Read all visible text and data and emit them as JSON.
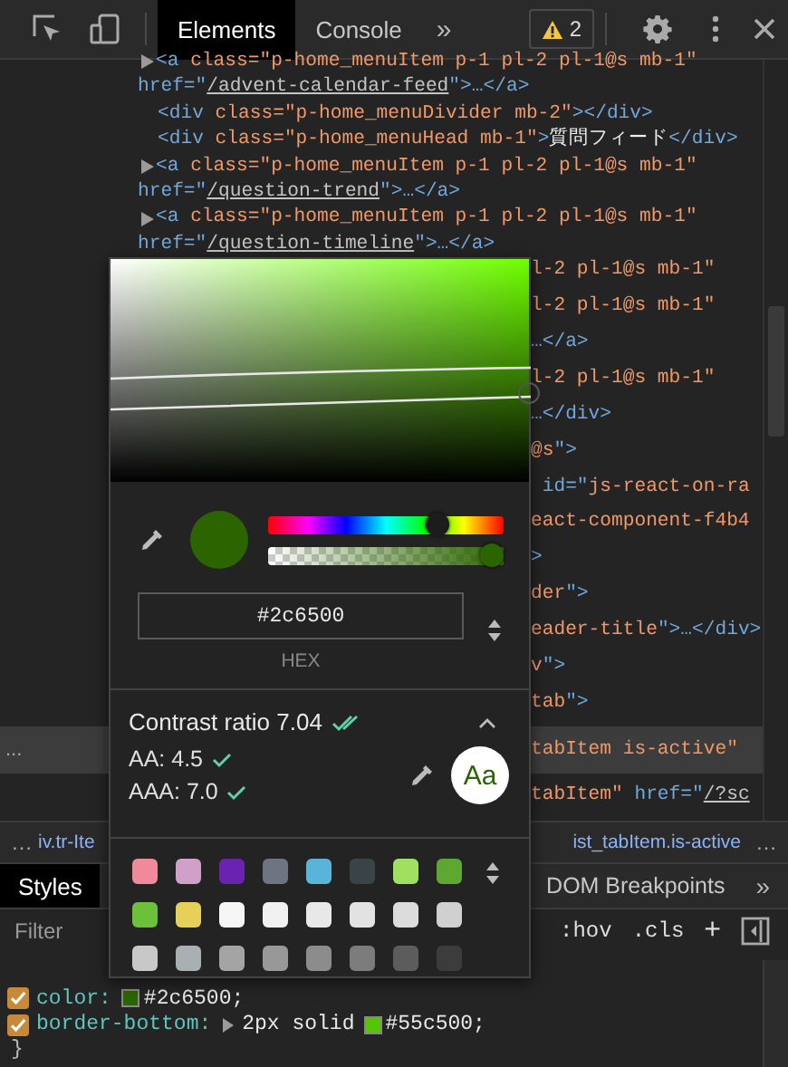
{
  "toolbar": {
    "tabs": [
      {
        "label": "Elements",
        "selected": true
      },
      {
        "label": "Console",
        "selected": false
      }
    ],
    "more_tabs": "»",
    "warnings": "2"
  },
  "dom_lines": [
    {
      "kind": "open",
      "expanded": false,
      "tokens": [
        {
          "t": "<a ",
          "kind": "tag"
        },
        {
          "t": "class=\"p-home_menuItem p-1 pl-2 pl-1@s mb-1\"",
          "kind": "attr"
        }
      ]
    },
    {
      "kind": "wrap",
      "tokens": [
        {
          "t": "href=\"",
          "kind": "tag"
        },
        {
          "t": "/advent-calendar-feed",
          "kind": "link"
        },
        {
          "t": "\">…</a>",
          "kind": "tag"
        }
      ]
    },
    {
      "kind": "leaf",
      "tokens": [
        {
          "t": "<div ",
          "kind": "tag"
        },
        {
          "t": "class=\"p-home_menuDivider mb-2\"",
          "kind": "attr"
        },
        {
          "t": "></div>",
          "kind": "tag"
        }
      ]
    },
    {
      "kind": "leaf",
      "tokens": [
        {
          "t": "<div ",
          "kind": "tag"
        },
        {
          "t": "class=\"p-home_menuHead mb-1\"",
          "kind": "attr"
        },
        {
          "t": ">",
          "kind": "tag"
        },
        {
          "t": "質問フィード",
          "kind": "text"
        },
        {
          "t": "</div>",
          "kind": "tag"
        }
      ]
    },
    {
      "kind": "open",
      "expanded": false,
      "tokens": [
        {
          "t": "<a ",
          "kind": "tag"
        },
        {
          "t": "class=\"p-home_menuItem p-1 pl-2 pl-1@s mb-1\"",
          "kind": "attr"
        }
      ]
    },
    {
      "kind": "wrap",
      "tokens": [
        {
          "t": "href=\"",
          "kind": "tag"
        },
        {
          "t": "/question-trend",
          "kind": "link"
        },
        {
          "t": "\">…</a>",
          "kind": "tag"
        }
      ]
    },
    {
      "kind": "open",
      "expanded": false,
      "tokens": [
        {
          "t": "<a ",
          "kind": "tag"
        },
        {
          "t": "class=\"p-home_menuItem p-1 pl-2 pl-1@s mb-1\"",
          "kind": "attr"
        }
      ]
    },
    {
      "kind": "wrap",
      "tokens": [
        {
          "t": "href=\"",
          "kind": "tag"
        },
        {
          "t": "/question-timeline",
          "kind": "link"
        },
        {
          "t": "\">…</a>",
          "kind": "tag"
        }
      ]
    }
  ],
  "fragments": [
    {
      "selected": false,
      "tokens": [
        {
          "t": "l-2 pl-1@s mb-1\"",
          "kind": "attr"
        }
      ]
    },
    {
      "selected": false,
      "tokens": [
        {
          "t": "l-2 pl-1@s mb-1\"",
          "kind": "attr"
        }
      ]
    },
    {
      "selected": false,
      "tokens": [
        {
          "t": "…</a>",
          "kind": "tag"
        }
      ]
    },
    {
      "selected": false,
      "tokens": [
        {
          "t": "l-2 pl-1@s mb-1\"",
          "kind": "attr"
        }
      ]
    },
    {
      "selected": false,
      "tokens": [
        {
          "t": "…</div>",
          "kind": "tag"
        }
      ]
    },
    {
      "selected": false,
      "tokens": [
        {
          "t": "@s",
          "kind": "attr"
        },
        {
          "t": "\">",
          "kind": "tag"
        }
      ]
    },
    {
      "selected": false,
      "tokens": [
        {
          "t": " id=\"",
          "kind": "tag"
        },
        {
          "t": "js-react-on-ra",
          "kind": "attr"
        }
      ]
    },
    {
      "selected": false,
      "tokens": [
        {
          "t": "eact-component-f4b4",
          "kind": "attr"
        }
      ]
    },
    {
      "selected": false,
      "tokens": [
        {
          "t": ">",
          "kind": "tag"
        }
      ]
    },
    {
      "selected": false,
      "tokens": [
        {
          "t": "der",
          "kind": "attr"
        },
        {
          "t": "\">",
          "kind": "tag"
        }
      ]
    },
    {
      "selected": false,
      "tokens": [
        {
          "t": "eader-title",
          "kind": "attr"
        },
        {
          "t": "\">…</div>",
          "kind": "tag"
        }
      ]
    },
    {
      "selected": false,
      "tokens": [
        {
          "t": "v",
          "kind": "attr"
        },
        {
          "t": "\">",
          "kind": "tag"
        }
      ]
    },
    {
      "selected": false,
      "tokens": [
        {
          "t": "tab",
          "kind": "attr"
        },
        {
          "t": "\">",
          "kind": "tag"
        }
      ]
    },
    {
      "selected": true,
      "marker": "...",
      "tokens": [
        {
          "t": "tabItem is-active\"",
          "kind": "attr"
        }
      ]
    },
    {
      "selected": false,
      "tokens": [
        {
          "t": "tabItem\"",
          "kind": "attr"
        },
        {
          "t": " href=\"",
          "kind": "tag"
        },
        {
          "t": "/?sc",
          "kind": "link"
        }
      ]
    }
  ],
  "breadcrumbs": {
    "start": "…",
    "items": [
      "iv.tr-Ite",
      "ist_tabItem.is-active"
    ],
    "end": "…"
  },
  "styles_tabs": {
    "tabs": [
      {
        "label": "Styles",
        "selected": true
      },
      {
        "label": "DOM Breakpoints",
        "selected": false
      }
    ],
    "more": "»"
  },
  "filter": {
    "placeholder": "Filter",
    "hov": ":hov",
    "cls": ".cls",
    "add": "+"
  },
  "declarations": [
    {
      "property": "color:",
      "checked": true,
      "value": "#2c6500;"
    },
    {
      "property": "border-bottom:",
      "checked": true,
      "expanded": false,
      "value_prefix": "2px solid",
      "value": "#55c500;"
    }
  ],
  "closing_brace": "}",
  "picker": {
    "hue_slider": {
      "level": 0.74
    },
    "alpha_slider": {
      "level": 1.0
    },
    "hex": "#2c6500",
    "format": "HEX",
    "contrast": {
      "label": "Contrast ratio",
      "ratio": "7.04",
      "passes": true,
      "expanded": true,
      "preview": "Aa",
      "levels": [
        {
          "label": "AA: 4.5",
          "passes": true
        },
        {
          "label": "AAA: 7.0",
          "passes": true
        }
      ]
    },
    "swatches": [
      {
        "color": "#f08a9a"
      },
      {
        "color": "#d0a0c8"
      },
      {
        "color": "#6a22b0"
      },
      {
        "color": "#6e7580"
      },
      {
        "color": "#58b4d8"
      },
      {
        "color": "#3a4448"
      },
      {
        "color": "#a0e060"
      },
      {
        "color": "#5ca830"
      },
      {
        "color": "#6cc03a"
      },
      {
        "color": "#e6d05a"
      },
      {
        "color": "#f6f6f6"
      },
      {
        "color": "#f0f0f0"
      },
      {
        "color": "#e8e8e8"
      },
      {
        "color": "#e2e2e2"
      },
      {
        "color": "#dcdcdc"
      },
      {
        "color": "#d0d0d0"
      },
      {
        "color": "#c8c8c8"
      },
      {
        "color": "#a8b0b4"
      },
      {
        "color": "#a4a4a4"
      },
      {
        "color": "#989898"
      },
      {
        "color": "#8c8c8c"
      },
      {
        "color": "#7c7c7c"
      },
      {
        "color": "#5c5c5c"
      },
      {
        "color": "#3c3c3c"
      }
    ]
  }
}
